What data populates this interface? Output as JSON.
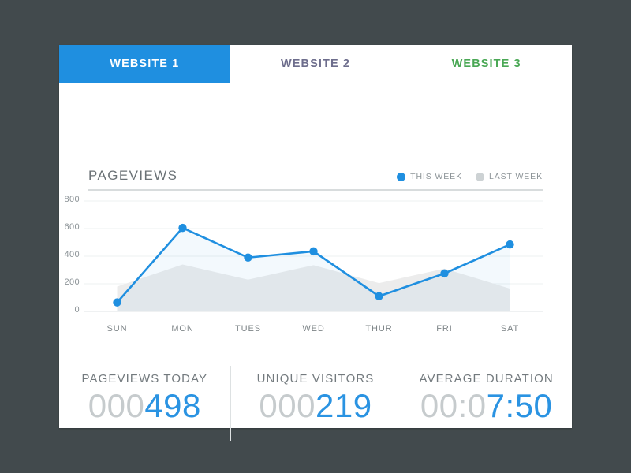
{
  "theme": {
    "background": "#424a4d",
    "card_background": "#ffffff",
    "accent_blue": "#1f8fe0",
    "accent_green": "#4aa855",
    "accent_purple": "#6d6d8c",
    "muted_gray": "#c6cbcd"
  },
  "tabs": [
    {
      "label": "WEBSITE 1",
      "active": true
    },
    {
      "label": "WEBSITE 2",
      "active": false
    },
    {
      "label": "WEBSITE 3",
      "active": false
    }
  ],
  "chart_header": {
    "title": "PAGEVIEWS",
    "legend": [
      {
        "label": "THIS WEEK",
        "color": "#1f8fe0"
      },
      {
        "label": "LAST WEEK",
        "color": "#cdd2d4"
      }
    ]
  },
  "chart_data": {
    "type": "line",
    "title": "PAGEVIEWS",
    "xlabel": "",
    "ylabel": "",
    "categories": [
      "SUN",
      "MON",
      "TUES",
      "WED",
      "THUR",
      "FRI",
      "SAT"
    ],
    "ylim": [
      0,
      800
    ],
    "yticks": [
      0,
      200,
      400,
      600,
      800
    ],
    "grid": true,
    "legend_position": "top-right",
    "series": [
      {
        "name": "THIS WEEK",
        "color": "#1f8fe0",
        "style": "line-with-markers-and-fill",
        "values": [
          65,
          605,
          390,
          435,
          110,
          275,
          485
        ]
      },
      {
        "name": "LAST WEEK",
        "color": "#cdd2d4",
        "style": "area",
        "values": [
          180,
          340,
          230,
          335,
          205,
          310,
          165
        ]
      }
    ]
  },
  "stats": [
    {
      "label": "PAGEVIEWS TODAY",
      "leading": "000",
      "value": "498",
      "full": "000498"
    },
    {
      "label": "UNIQUE VISITORS",
      "leading": "000",
      "value": "219",
      "full": "000219"
    },
    {
      "label": "AVERAGE DURATION",
      "leading": "00:0",
      "value": "7:50",
      "full": "00:07:50"
    }
  ]
}
